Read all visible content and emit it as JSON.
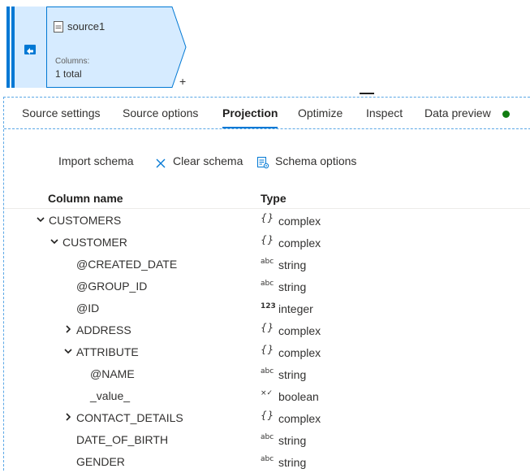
{
  "node": {
    "title": "source1",
    "columns_label": "Columns:",
    "columns_value": "1 total",
    "add_symbol": "+"
  },
  "tabs": [
    {
      "label": "Source settings",
      "active": false
    },
    {
      "label": "Source options",
      "active": false
    },
    {
      "label": "Projection",
      "active": true
    },
    {
      "label": "Optimize",
      "active": false
    },
    {
      "label": "Inspect",
      "active": false
    },
    {
      "label": "Data preview",
      "active": false
    }
  ],
  "toolbar": {
    "import_schema": "Import schema",
    "clear_schema": "Clear schema",
    "schema_options": "Schema options"
  },
  "table": {
    "col_name": "Column name",
    "col_type": "Type",
    "rows": [
      {
        "name": "CUSTOMERS",
        "level": 0,
        "expander": "expanded",
        "type_icon": "{}",
        "type": "complex"
      },
      {
        "name": "CUSTOMER",
        "level": 1,
        "expander": "expanded",
        "type_icon": "{}",
        "type": "complex"
      },
      {
        "name": "@CREATED_DATE",
        "level": 2,
        "expander": "none",
        "type_icon": "abc",
        "type": "string"
      },
      {
        "name": "@GROUP_ID",
        "level": 2,
        "expander": "none",
        "type_icon": "abc",
        "type": "string"
      },
      {
        "name": "@ID",
        "level": 2,
        "expander": "none",
        "type_icon": "123",
        "type": "integer"
      },
      {
        "name": "ADDRESS",
        "level": 2,
        "expander": "collapsed",
        "type_icon": "{}",
        "type": "complex"
      },
      {
        "name": "ATTRIBUTE",
        "level": 2,
        "expander": "expanded",
        "type_icon": "{}",
        "type": "complex"
      },
      {
        "name": "@NAME",
        "level": 3,
        "expander": "none",
        "type_icon": "abc",
        "type": "string"
      },
      {
        "name": "_value_",
        "level": 3,
        "expander": "none",
        "type_icon": "×✓",
        "type": "boolean"
      },
      {
        "name": "CONTACT_DETAILS",
        "level": 2,
        "expander": "collapsed",
        "type_icon": "{}",
        "type": "complex"
      },
      {
        "name": "DATE_OF_BIRTH",
        "level": 2,
        "expander": "none",
        "type_icon": "abc",
        "type": "string"
      },
      {
        "name": "GENDER",
        "level": 2,
        "expander": "none",
        "type_icon": "abc",
        "type": "string"
      }
    ]
  },
  "colors": {
    "accent": "#0078d4",
    "node_fill": "#d6ebff",
    "status_green": "#107c10"
  }
}
